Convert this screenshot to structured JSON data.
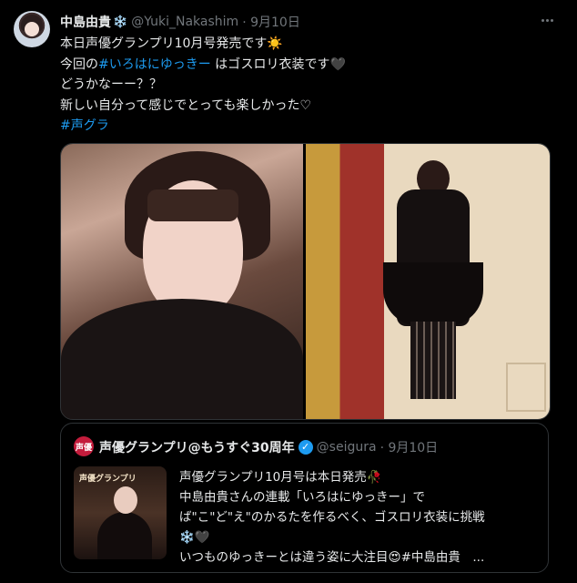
{
  "tweet": {
    "author_name": "中島由貴",
    "author_badge": "❄️",
    "handle": "@Yuki_Nakashim",
    "date": "· 9月10日",
    "lines": [
      "本日声優グランプリ10月号発売です☀️",
      "今回の",
      "#いろはにゆっきー",
      " はゴスロリ衣装です🖤",
      "どうかなーー？？",
      "新しい自分って感じでとっても楽しかった♡",
      "#声グラ"
    ]
  },
  "quote": {
    "avatar_label": "声優",
    "author_name": "声優グランプリ@もうすぐ30周年",
    "verified": "✓",
    "handle": "@seigura",
    "date": "· 9月10日",
    "thumb_label": "声優グランプリ",
    "lines": [
      "声優グランプリ10月号は本日発売🥀",
      " 中島由貴さんの連載「いろはにゆっきー」で",
      "ば\"こ\"ど\"え\"のかるたを作るべく、ゴスロリ衣装に挑戦",
      "❄️🖤",
      " いつものゆっきーとは違う姿に大注目😍#中島由貴　..."
    ]
  },
  "colors": {
    "background": "#000000",
    "text": "#e7e9ea",
    "muted": "#71767b",
    "link": "#1d9bf0",
    "border": "#2f3336"
  }
}
